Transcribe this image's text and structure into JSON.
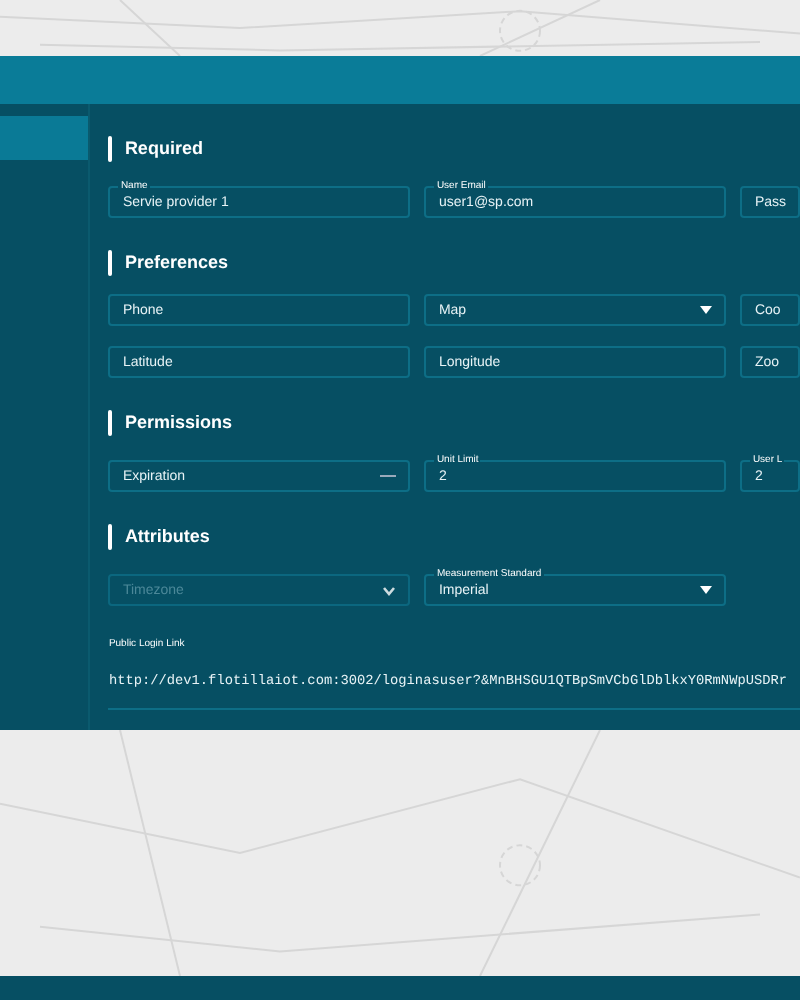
{
  "sidebar": {
    "items": [
      {
        "selected": true
      }
    ]
  },
  "sections": [
    {
      "title": "Required",
      "rows": [
        [
          {
            "kind": "text",
            "label": "Name",
            "value": "Servie provider 1"
          },
          {
            "kind": "text",
            "label": "User Email",
            "value": "user1@sp.com"
          },
          {
            "kind": "text",
            "placeholder": "Pass"
          }
        ]
      ]
    },
    {
      "title": "Preferences",
      "rows": [
        [
          {
            "kind": "text",
            "placeholder": "Phone"
          },
          {
            "kind": "select",
            "placeholder": "Map"
          },
          {
            "kind": "text",
            "placeholder": "Coo"
          }
        ],
        [
          {
            "kind": "text",
            "placeholder": "Latitude"
          },
          {
            "kind": "text",
            "placeholder": "Longitude"
          },
          {
            "kind": "text",
            "placeholder": "Zoo"
          }
        ]
      ]
    },
    {
      "title": "Permissions",
      "rows": [
        [
          {
            "kind": "date",
            "placeholder": "Expiration"
          },
          {
            "kind": "text",
            "label": "Unit Limit",
            "value": "2"
          },
          {
            "kind": "text",
            "label": "User L",
            "value": "2"
          }
        ]
      ]
    },
    {
      "title": "Attributes",
      "rows": [
        [
          {
            "kind": "chevron",
            "placeholder": "Timezone",
            "disabled": true
          },
          {
            "kind": "select",
            "label": "Measurement Standard",
            "value": "Imperial"
          }
        ]
      ]
    }
  ],
  "public_link": {
    "label": "Public Login Link",
    "value": "http://dev1.flotillaiot.com:3002/loginasuser?&MnBHSGU1QTBpSmVCbGlDblkxY0RmNWpUSDRr"
  }
}
